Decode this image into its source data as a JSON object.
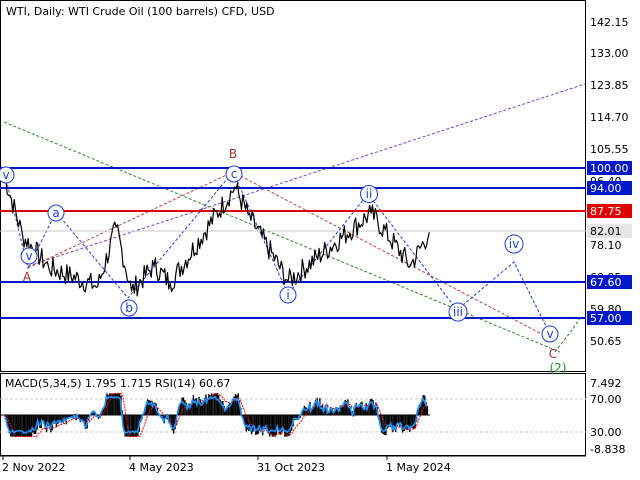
{
  "header": {
    "symbol": "WTI",
    "timeframe": "Daily:",
    "instrument": "WTI Crude Oil (100 barrels) CFD, USD"
  },
  "colors": {
    "background": "#ffffff",
    "price_line": "#000000",
    "level_line": "#0018c8",
    "level_label_bg": "#0018c8",
    "resistance_line": "#e00000",
    "resistance_label_bg": "#e00000",
    "current_price_label_bg": "#e6e6e6",
    "wave_blue": "#1f3fd8",
    "wave_red": "#a03030",
    "wave_green": "#2a8a2a",
    "trend_purple": "#8040c0",
    "trend_green": "#2a8a2a",
    "macd_hist": "#000000",
    "macd_signal": "#ff0000",
    "rsi_line": "#1e90ff"
  },
  "price_axis": {
    "ticks": [
      "142.15",
      "133.00",
      "123.85",
      "114.70",
      "105.55",
      "96.40",
      "78.10",
      "68.95",
      "59.80",
      "50.65"
    ]
  },
  "levels": {
    "blue": [
      "100.00",
      "94.00",
      "67.60",
      "57.00"
    ],
    "red": [
      "87.75"
    ],
    "current": "82.01"
  },
  "wave_labels": {
    "circled_blue": [
      "v",
      "a",
      "v",
      "b",
      "c",
      "i",
      "ii",
      "iii",
      "iv",
      "v"
    ],
    "red": [
      "A",
      "B",
      "C"
    ],
    "green": [
      "(2)"
    ]
  },
  "indicator": {
    "caption": "MACD(5,34,5) 1.795 1.715 RSI(14) 60.67",
    "axis_ticks": [
      "7.492",
      "70.00",
      "30.00",
      "-8.838"
    ]
  },
  "time_axis": {
    "labels": [
      "2 Nov 2022",
      "4 May 2023",
      "31 Oct 2023",
      "1 May 2024"
    ]
  },
  "chart_data": {
    "type": "line",
    "title": "WTI, Daily:  WTI Crude Oil (100 barrels) CFD, USD",
    "xlabel": "",
    "ylabel": "",
    "ylim": [
      46,
      148
    ],
    "x_ticks": [
      "2 Nov 2022",
      "4 May 2023",
      "31 Oct 2023",
      "1 May 2024"
    ],
    "y_ticks": [
      142.15,
      133.0,
      123.85,
      114.7,
      105.55,
      96.4,
      78.1,
      68.95,
      59.8,
      50.65
    ],
    "horizontal_levels": [
      100.0,
      94.0,
      87.75,
      67.6,
      57.0
    ],
    "last_price": 82.01,
    "series": [
      {
        "name": "",
        "x": [
          "2 Nov 2022",
          "30 Nov 2022",
          "6 Jan 2023",
          "17 Mar 2023",
          "12 Apr 2023",
          "4 May 2023",
          "5 Jun 2023",
          "28 Jun 2023",
          "28 Sep 2023",
          "17 Oct 2023",
          "13 Dec 2023",
          "9 Apr 2024",
          "4 Jun 2024",
          "1 Jul 2024"
        ],
        "values": [
          99.5,
          81.0,
          72.0,
          66.5,
          83.5,
          65.2,
          72.5,
          67.5,
          95.0,
          87.0,
          68.0,
          87.5,
          72.5,
          82.01
        ]
      }
    ],
    "forecast_path": {
      "x": [
        "1 Jul 2024",
        "1 Sep 2024",
        "1 Oct 2024",
        "15 Dec 2024"
      ],
      "values": [
        82.01,
        60.0,
        74.0,
        51.0
      ]
    },
    "indicator": {
      "name": "MACD(5,34,5) / RSI(14)",
      "macd": 1.795,
      "signal": 1.715,
      "rsi": 60.67,
      "macd_range": [
        -8.838,
        7.492
      ],
      "rsi_levels": [
        30,
        70
      ]
    }
  }
}
